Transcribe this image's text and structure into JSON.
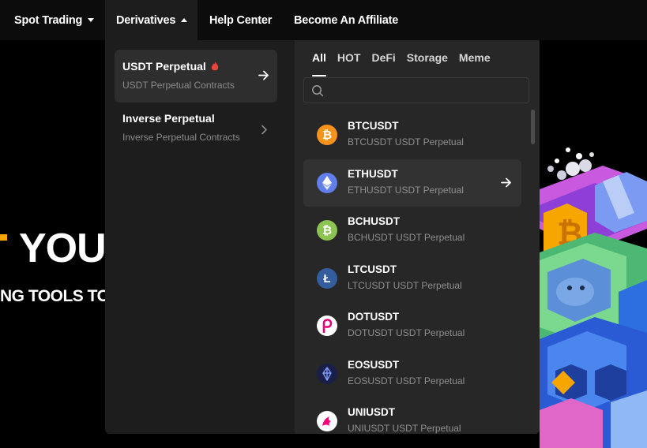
{
  "nav": {
    "spot_trading": "Spot Trading",
    "derivatives": "Derivatives",
    "help_center": "Help Center",
    "become_affiliate": "Become An Affiliate"
  },
  "hero": {
    "title_fragment": "YOU",
    "subtitle_fragment": "NG TOOLS TO",
    "accent_color": "#f7a600"
  },
  "menu": {
    "items": [
      {
        "title": "USDT Perpetual",
        "subtitle": "USDT Perpetual Contracts",
        "badge_icon": "flame-icon",
        "trail_icon": "arrow-right-icon"
      },
      {
        "title": "Inverse Perpetual",
        "subtitle": "Inverse Perpetual Contracts",
        "trail_icon": "chevron-right-icon"
      }
    ]
  },
  "tabs": [
    "All",
    "HOT",
    "DeFi",
    "Storage",
    "Meme"
  ],
  "search": {
    "placeholder": ""
  },
  "coins": [
    {
      "symbol": "BTCUSDT",
      "desc": "BTCUSDT USDT Perpetual",
      "icon": "bitcoin-icon",
      "color": "#f7931a",
      "glyph": "₿"
    },
    {
      "symbol": "ETHUSDT",
      "desc": "ETHUSDT USDT Perpetual",
      "icon": "ethereum-icon",
      "color": "#627eea",
      "glyph": "◆"
    },
    {
      "symbol": "BCHUSDT",
      "desc": "BCHUSDT USDT Perpetual",
      "icon": "bitcoin-cash-icon",
      "color": "#8dc351",
      "glyph": "₿"
    },
    {
      "symbol": "LTCUSDT",
      "desc": "LTCUSDT USDT Perpetual",
      "icon": "litecoin-icon",
      "color": "#345d9d",
      "glyph": "Ł"
    },
    {
      "symbol": "DOTUSDT",
      "desc": "DOTUSDT USDT Perpetual",
      "icon": "polkadot-icon",
      "color": "#ffffff",
      "glyph": "P"
    },
    {
      "symbol": "EOSUSDT",
      "desc": "EOSUSDT USDT Perpetual",
      "icon": "eos-icon",
      "color": "#1a1f4a",
      "glyph": "◇"
    },
    {
      "symbol": "UNIUSDT",
      "desc": "UNIUSDT USDT Perpetual",
      "icon": "uniswap-icon",
      "color": "#ffffff",
      "glyph": "🦄"
    }
  ]
}
